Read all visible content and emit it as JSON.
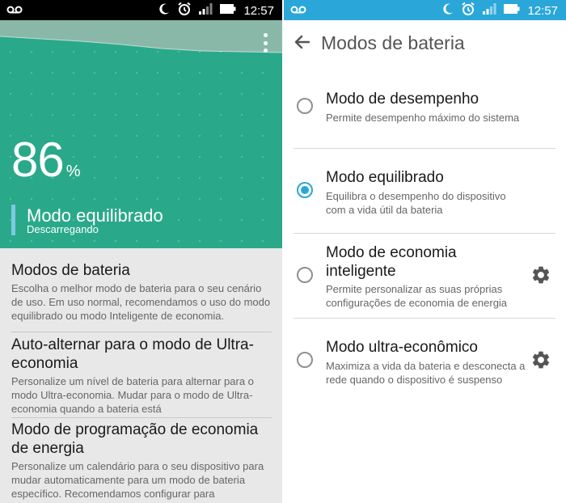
{
  "status_bar": {
    "time": "12:57",
    "icons": [
      "voicemail-icon",
      "moon-icon",
      "alarm-icon",
      "signal-icon",
      "battery-icon"
    ]
  },
  "left": {
    "battery": {
      "percent": "86",
      "percent_sign": "%",
      "mode": "Modo equilibrado",
      "status": "Descarregando"
    },
    "colors": {
      "hero": "#2aa98a",
      "mode_bar": "#7ec8e3"
    },
    "sections": [
      {
        "title": "Modos de bateria",
        "description": "Escolha o melhor modo de bateria para o seu cenário de uso. Em uso normal, recomendamos o uso do modo equilibrado ou modo Inteligente de economia."
      },
      {
        "title": "Auto-alternar para o modo de Ultra-economia",
        "description": "Personalize um nível de bateria para alternar para o modo Ultra-economia. Mudar para o modo de Ultra-economia quando a bateria está"
      },
      {
        "title": "Modo de programação de economia de energia",
        "description": "Personalize um calendário para o seu dispositivo para mudar automaticamente para um modo de bateria específico. Recomendamos configurar para"
      }
    ]
  },
  "right": {
    "title": "Modos de bateria",
    "accent": "#2aa7d8",
    "options": [
      {
        "title": "Modo de desempenho",
        "description": "Permite desempenho máximo do sistema",
        "selected": false,
        "settings": false
      },
      {
        "title": "Modo equilibrado",
        "description": "Equilibra o desempenho do dispositivo com a vida útil da bateria",
        "selected": true,
        "settings": false
      },
      {
        "title": "Modo de economia inteligente",
        "description": "Permite personalizar as suas próprias configurações de economia de energia",
        "selected": false,
        "settings": true
      },
      {
        "title": "Modo ultra-econômico",
        "description": "Maximiza a vida da bateria e desconecta a rede quando o dispositivo é suspenso",
        "selected": false,
        "settings": true
      }
    ]
  }
}
